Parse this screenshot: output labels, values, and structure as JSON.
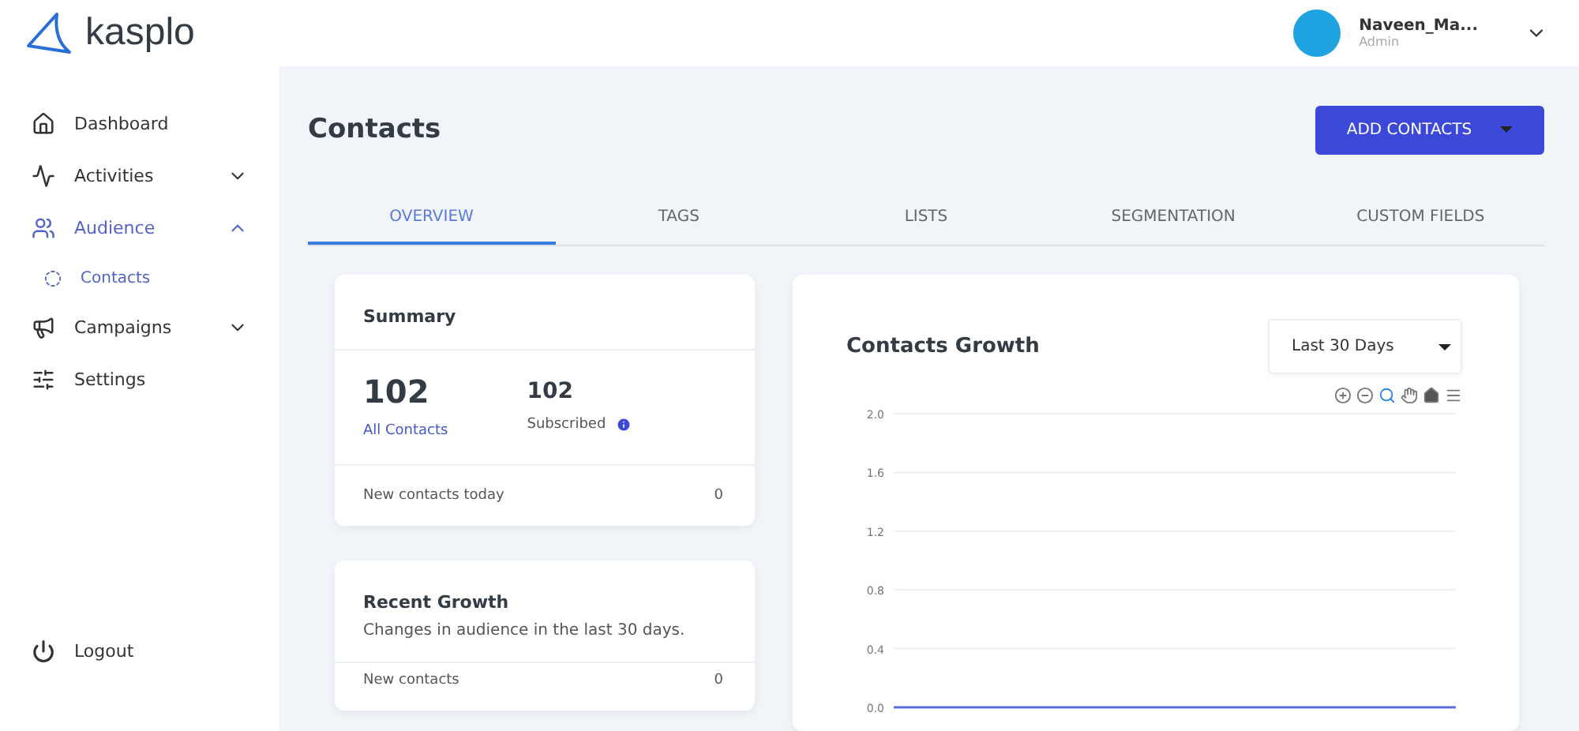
{
  "brand": {
    "name": "kasplo"
  },
  "user": {
    "name": "Naveen_Ma...",
    "role": "Admin"
  },
  "sidebar": {
    "items": [
      {
        "label": "Dashboard",
        "selected": false
      },
      {
        "label": "Activities",
        "expanded": false,
        "selected": false
      },
      {
        "label": "Audience",
        "expanded": true,
        "selected": true,
        "children": [
          {
            "label": "Contacts",
            "selected": true
          }
        ]
      },
      {
        "label": "Campaigns",
        "expanded": false,
        "selected": false
      },
      {
        "label": "Settings",
        "selected": false
      }
    ],
    "logout": "Logout"
  },
  "page": {
    "title": "Contacts",
    "action": "ADD CONTACTS"
  },
  "tabs": [
    {
      "label": "OVERVIEW",
      "selected": true
    },
    {
      "label": "TAGS",
      "selected": false
    },
    {
      "label": "LISTS",
      "selected": false
    },
    {
      "label": "SEGMENTATION",
      "selected": false
    },
    {
      "label": "CUSTOM FIELDS",
      "selected": false
    }
  ],
  "summary": {
    "title": "Summary",
    "total": "102",
    "total_label": "All Contacts",
    "subscribed": "102",
    "subscribed_label": "Subscribed",
    "today_label": "New contacts today",
    "today_value": "0"
  },
  "recent_growth": {
    "title": "Recent Growth",
    "subtitle": "Changes in audience in the last 30 days.",
    "row_label": "New contacts",
    "row_value": "0"
  },
  "growth_chart": {
    "title": "Contacts Growth",
    "range": "Last 30 Days",
    "chart_data": {
      "type": "line",
      "grid": true,
      "ylim": [
        0,
        2
      ],
      "yticks": [
        {
          "value": 0,
          "label": "0.0"
        },
        {
          "value": 0.4,
          "label": "0.4"
        },
        {
          "value": 0.8,
          "label": "0.8"
        },
        {
          "value": 1.2,
          "label": "1.2"
        },
        {
          "value": 1.6,
          "label": "1.6"
        },
        {
          "value": 2,
          "label": "2.0"
        }
      ],
      "series": [
        {
          "color": "#5b6ee1",
          "values": [
            0,
            0,
            0,
            0,
            0,
            0,
            0,
            0,
            0,
            0,
            0
          ]
        }
      ]
    }
  }
}
